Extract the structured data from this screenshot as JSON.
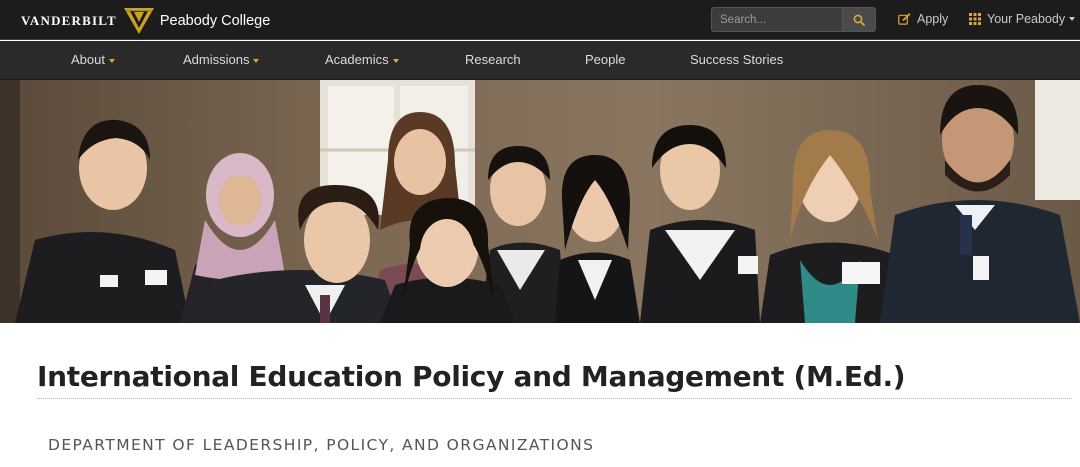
{
  "brand": {
    "wordmark": "VANDERBILT",
    "college": "Peabody College",
    "gold": "#c9a227",
    "dark": "#1c1c1c"
  },
  "search": {
    "placeholder": "Search...",
    "icon": "search-icon"
  },
  "utility_links": [
    {
      "label": "Apply",
      "icon": "edit-icon"
    },
    {
      "label": "Your Peabody",
      "icon": "grid-icon",
      "has_dropdown": true
    }
  ],
  "nav": {
    "items": [
      {
        "label": "About",
        "has_dropdown": true
      },
      {
        "label": "Admissions",
        "has_dropdown": true
      },
      {
        "label": "Academics",
        "has_dropdown": true
      },
      {
        "label": "Research",
        "has_dropdown": false
      },
      {
        "label": "People",
        "has_dropdown": false
      },
      {
        "label": "Success Stories",
        "has_dropdown": false
      }
    ]
  },
  "hero": {
    "subject": "group photo of ten students"
  },
  "main": {
    "title": "International Education Policy and Management (M.Ed.)",
    "department": "DEPARTMENT OF LEADERSHIP, POLICY, AND ORGANIZATIONS"
  }
}
